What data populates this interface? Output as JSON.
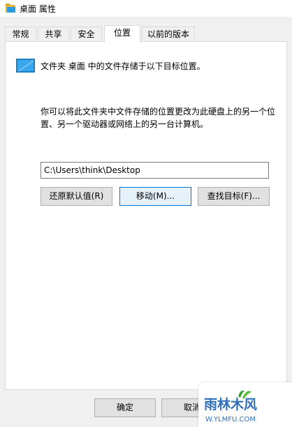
{
  "window": {
    "title": "桌面 属性"
  },
  "tabs": [
    {
      "label": "常规"
    },
    {
      "label": "共享"
    },
    {
      "label": "安全"
    },
    {
      "label": "位置",
      "active": true
    },
    {
      "label": "以前的版本"
    }
  ],
  "location": {
    "intro": "文件夹 桌面 中的文件存储于以下目标位置。",
    "description": "你可以将此文件夹中文件存储的位置更改为此硬盘上的另一个位置、另一个驱动器或网络上的另一台计算机。",
    "path_value": "C:\\Users\\think\\Desktop",
    "restore_button": "还原默认值(R)",
    "move_button": "移动(M)...",
    "find_target_button": "查找目标(F)..."
  },
  "footer": {
    "ok_button": "确定",
    "cancel_button": "取消"
  },
  "watermark": {
    "brand": "雨林木风",
    "url": "W.YLMFU.COM"
  },
  "colors": {
    "accent": "#0078d7",
    "folder_blue": "#2a9be0",
    "watermark_green": "#3fa53a"
  }
}
